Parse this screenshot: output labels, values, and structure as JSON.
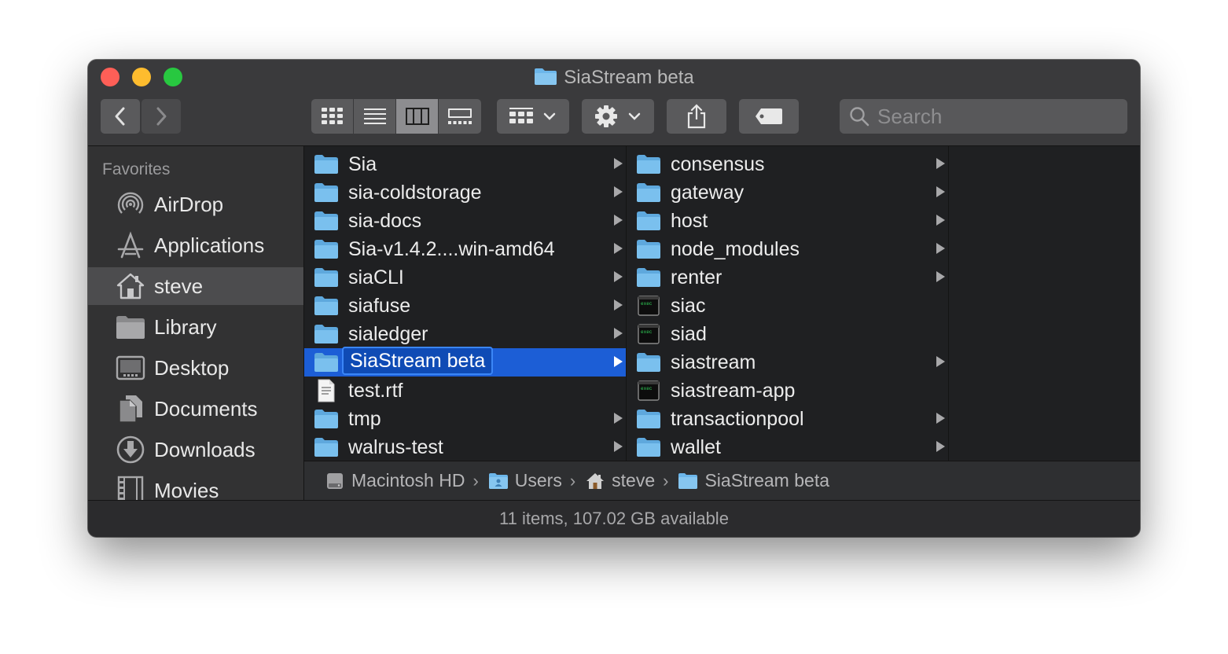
{
  "window": {
    "title": "SiaStream beta"
  },
  "toolbar": {
    "view_modes": [
      "icons",
      "list",
      "columns",
      "gallery"
    ],
    "active_view": "columns"
  },
  "search": {
    "placeholder": "Search",
    "value": ""
  },
  "sidebar": {
    "heading": "Favorites",
    "items": [
      {
        "label": "AirDrop",
        "icon": "airdrop-icon"
      },
      {
        "label": "Applications",
        "icon": "applications-icon"
      },
      {
        "label": "steve",
        "icon": "home-icon",
        "selected": true
      },
      {
        "label": "Library",
        "icon": "folder-icon"
      },
      {
        "label": "Desktop",
        "icon": "desktop-icon"
      },
      {
        "label": "Documents",
        "icon": "documents-icon"
      },
      {
        "label": "Downloads",
        "icon": "downloads-icon"
      },
      {
        "label": "Movies",
        "icon": "movies-icon"
      }
    ]
  },
  "column1": {
    "items": [
      {
        "name": "Sia",
        "type": "folder"
      },
      {
        "name": "sia-coldstorage",
        "type": "folder"
      },
      {
        "name": "sia-docs",
        "type": "folder"
      },
      {
        "name": "Sia-v1.4.2....win-amd64",
        "type": "folder"
      },
      {
        "name": "siaCLI",
        "type": "folder"
      },
      {
        "name": "siafuse",
        "type": "folder"
      },
      {
        "name": "sialedger",
        "type": "folder"
      },
      {
        "name": "SiaStream beta",
        "type": "folder",
        "selected": true
      },
      {
        "name": "test.rtf",
        "type": "file"
      },
      {
        "name": "tmp",
        "type": "folder"
      },
      {
        "name": "walrus-test",
        "type": "folder"
      }
    ]
  },
  "column2": {
    "items": [
      {
        "name": "consensus",
        "type": "folder"
      },
      {
        "name": "gateway",
        "type": "folder"
      },
      {
        "name": "host",
        "type": "folder"
      },
      {
        "name": "node_modules",
        "type": "folder"
      },
      {
        "name": "renter",
        "type": "folder"
      },
      {
        "name": "siac",
        "type": "exec"
      },
      {
        "name": "siad",
        "type": "exec"
      },
      {
        "name": "siastream",
        "type": "folder"
      },
      {
        "name": "siastream-app",
        "type": "exec"
      },
      {
        "name": "transactionpool",
        "type": "folder"
      },
      {
        "name": "wallet",
        "type": "folder"
      }
    ]
  },
  "pathbar": {
    "items": [
      {
        "label": "Macintosh HD",
        "icon": "hard-drive-icon"
      },
      {
        "label": "Users",
        "icon": "users-folder-icon"
      },
      {
        "label": "steve",
        "icon": "home-icon"
      },
      {
        "label": "SiaStream beta",
        "icon": "folder-icon"
      }
    ]
  },
  "status": {
    "text": "11 items, 107.02 GB available"
  },
  "colors": {
    "selection": "#1c5ed6",
    "folder": "#6cb6ea",
    "close": "#fe5f57",
    "minimize": "#febc2e",
    "maximize": "#28c840"
  }
}
